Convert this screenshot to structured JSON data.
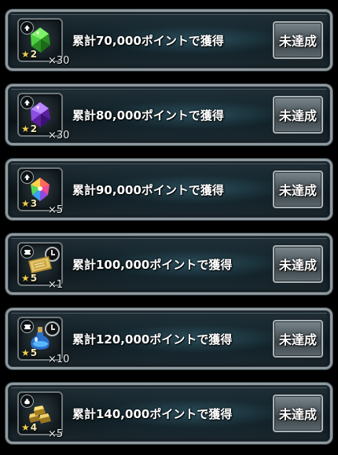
{
  "rewards": [
    {
      "description": "累計70,000ポイントで獲得",
      "quantity": "×30",
      "rarity_stars": "2",
      "item_icon": "green-gem-icon",
      "badge_icon": "up-arrow-badge-icon",
      "status_label": "未達成",
      "gem_color": "#3ec23a"
    },
    {
      "description": "累計80,000ポイントで獲得",
      "quantity": "×30",
      "rarity_stars": "2",
      "item_icon": "purple-gem-icon",
      "badge_icon": "up-arrow-badge-icon",
      "status_label": "未達成",
      "gem_color": "#8a3ed6"
    },
    {
      "description": "累計90,000ポイントで獲得",
      "quantity": "×5",
      "rarity_stars": "3",
      "item_icon": "rainbow-gem-icon",
      "badge_icon": "up-arrow-badge-icon",
      "status_label": "未達成",
      "gem_color": "#e04848"
    },
    {
      "description": "累計100,000ポイントで獲得",
      "quantity": "×1",
      "rarity_stars": "5",
      "item_icon": "gold-ticket-icon",
      "badge_icon": "ticket-badge-icon",
      "status_label": "未達成",
      "gem_color": "#d6b44a"
    },
    {
      "description": "累計120,000ポイントで獲得",
      "quantity": "×10",
      "rarity_stars": "5",
      "item_icon": "blue-potion-icon",
      "badge_icon": "ticket-badge-icon",
      "status_label": "未達成",
      "gem_color": "#3a8ee0"
    },
    {
      "description": "累計140,000ポイントで獲得",
      "quantity": "×5",
      "rarity_stars": "4",
      "item_icon": "gold-bars-icon",
      "badge_icon": "bag-badge-icon",
      "status_label": "未達成",
      "gem_color": "#e2b838"
    }
  ]
}
